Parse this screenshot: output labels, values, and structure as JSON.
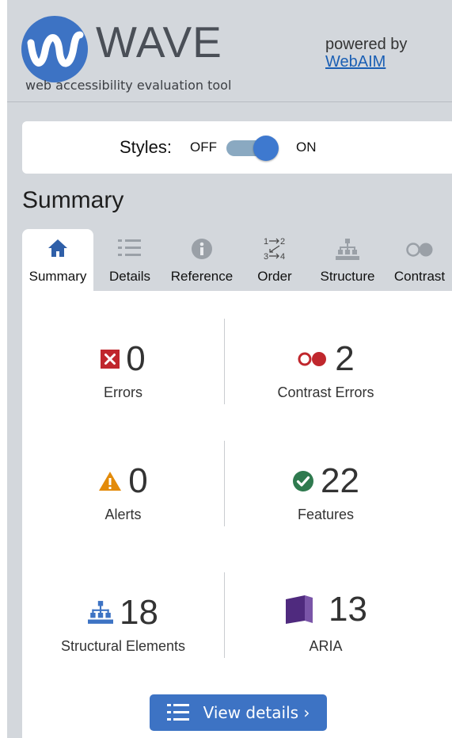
{
  "header": {
    "logo_text": "WAVE",
    "tagline": "web accessibility evaluation tool",
    "powered_by": "powered by",
    "webaim_link": "WebAIM"
  },
  "styles": {
    "label": "Styles:",
    "off_label": "OFF",
    "on_label": "ON",
    "state": "on"
  },
  "summary_heading": "Summary",
  "tabs": [
    {
      "label": "Summary",
      "icon": "home-icon",
      "active": true
    },
    {
      "label": "Details",
      "icon": "list-icon",
      "active": false
    },
    {
      "label": "Reference",
      "icon": "info-icon",
      "active": false
    },
    {
      "label": "Order",
      "icon": "order-icon",
      "active": false
    },
    {
      "label": "Structure",
      "icon": "structure-icon",
      "active": false
    },
    {
      "label": "Contrast",
      "icon": "contrast-icon",
      "active": false
    }
  ],
  "metrics": {
    "errors": {
      "count": "0",
      "label": "Errors",
      "icon": "error-icon"
    },
    "contrast_errors": {
      "count": "2",
      "label": "Contrast Errors",
      "icon": "contrast-error-icon"
    },
    "alerts": {
      "count": "0",
      "label": "Alerts",
      "icon": "alert-icon"
    },
    "features": {
      "count": "22",
      "label": "Features",
      "icon": "feature-check-icon"
    },
    "structural": {
      "count": "18",
      "label": "Structural Elements",
      "icon": "structure-icon"
    },
    "aria": {
      "count": "13",
      "label": "ARIA",
      "icon": "aria-icon"
    }
  },
  "view_details": {
    "label": "View details ›",
    "icon": "list-icon"
  },
  "colors": {
    "accent": "#3d73c4",
    "error": "#c0272d",
    "alert": "#e38b0a",
    "feature": "#2f7a4f",
    "aria": "#4f2a7e",
    "background": "#d3d7dc"
  }
}
